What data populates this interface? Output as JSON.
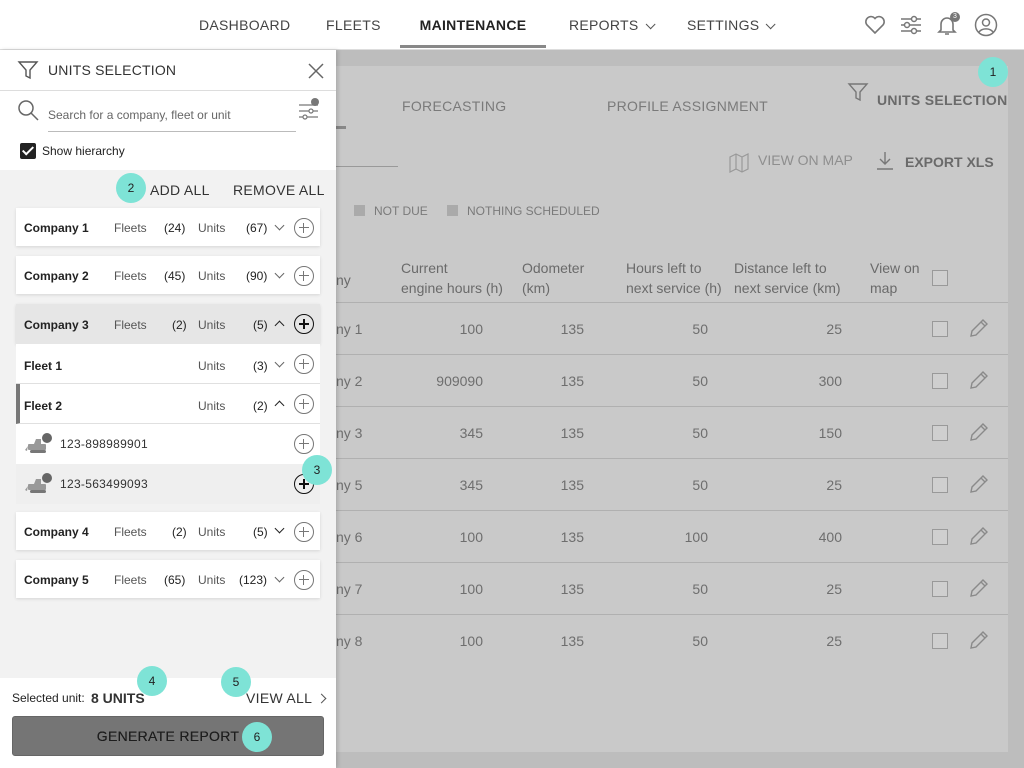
{
  "nav": {
    "items": [
      "DASHBOARD",
      "FLEETS",
      "MAINTENANCE",
      "REPORTS",
      "SETTINGS"
    ],
    "notification_count": "3"
  },
  "background": {
    "tabs": [
      "FORECASTING",
      "PROFILE ASSIGNMENT"
    ],
    "units_selection_label": "UNITS SELECTION",
    "view_on_map_label": "VIEW ON MAP",
    "export_label": "EXPORT XLS",
    "legend": [
      "NOT DUE",
      "NOTHING SCHEDULED"
    ],
    "columns": {
      "company": "ny",
      "engine_hours": [
        "Current",
        "engine hours (h)"
      ],
      "odometer": [
        "Odometer",
        "(km)"
      ],
      "hours_left": [
        "Hours left to",
        "next service (h)"
      ],
      "distance_left": [
        "Distance left to",
        "next service (km)"
      ],
      "view_on_map": [
        "View on",
        "map"
      ]
    },
    "rows": [
      {
        "company": "ny 1",
        "engine_hours": "100",
        "odometer": "135",
        "hours_left": "50",
        "distance_left": "25"
      },
      {
        "company": "ny 2",
        "engine_hours": "909090",
        "odometer": "135",
        "hours_left": "50",
        "distance_left": "300"
      },
      {
        "company": "ny 3",
        "engine_hours": "345",
        "odometer": "135",
        "hours_left": "50",
        "distance_left": "150"
      },
      {
        "company": "ny 5",
        "engine_hours": "345",
        "odometer": "135",
        "hours_left": "50",
        "distance_left": "25"
      },
      {
        "company": "ny 6",
        "engine_hours": "100",
        "odometer": "135",
        "hours_left": "100",
        "distance_left": "400"
      },
      {
        "company": "ny 7",
        "engine_hours": "100",
        "odometer": "135",
        "hours_left": "50",
        "distance_left": "25"
      },
      {
        "company": "ny 8",
        "engine_hours": "100",
        "odometer": "135",
        "hours_left": "50",
        "distance_left": "25"
      }
    ]
  },
  "panel": {
    "title": "UNITS SELECTION",
    "search_placeholder": "Search for a company, fleet or unit",
    "show_hierarchy_label": "Show hierarchy",
    "add_all_label": "ADD ALL",
    "remove_all_label": "REMOVE ALL",
    "fleets_label": "Fleets",
    "units_label": "Units",
    "companies_top": [
      {
        "name": "Company 1",
        "fleets": "(24)",
        "units": "(67)"
      },
      {
        "name": "Company 2",
        "fleets": "(45)",
        "units": "(90)"
      },
      {
        "name": "Company 3",
        "fleets": "(2)",
        "units": "(5)"
      }
    ],
    "fleets": [
      {
        "name": "Fleet 1",
        "units": "(3)"
      },
      {
        "name": "Fleet 2",
        "units": "(2)"
      }
    ],
    "units": [
      "123-898989901",
      "123-563499093"
    ],
    "companies_bottom": [
      {
        "name": "Company 4",
        "fleets": "(2)",
        "units": "(5)"
      },
      {
        "name": "Company 5",
        "fleets": "(65)",
        "units": "(123)"
      }
    ],
    "selected_label": "Selected unit:",
    "selected_value": "8 UNITS",
    "view_all_label": "VIEW ALL",
    "generate_label": "GENERATE REPORT"
  },
  "badges": [
    "1",
    "2",
    "3",
    "4",
    "5",
    "6"
  ],
  "colors": {
    "badge": "#7ee3d6",
    "generate_button": "#757575"
  }
}
